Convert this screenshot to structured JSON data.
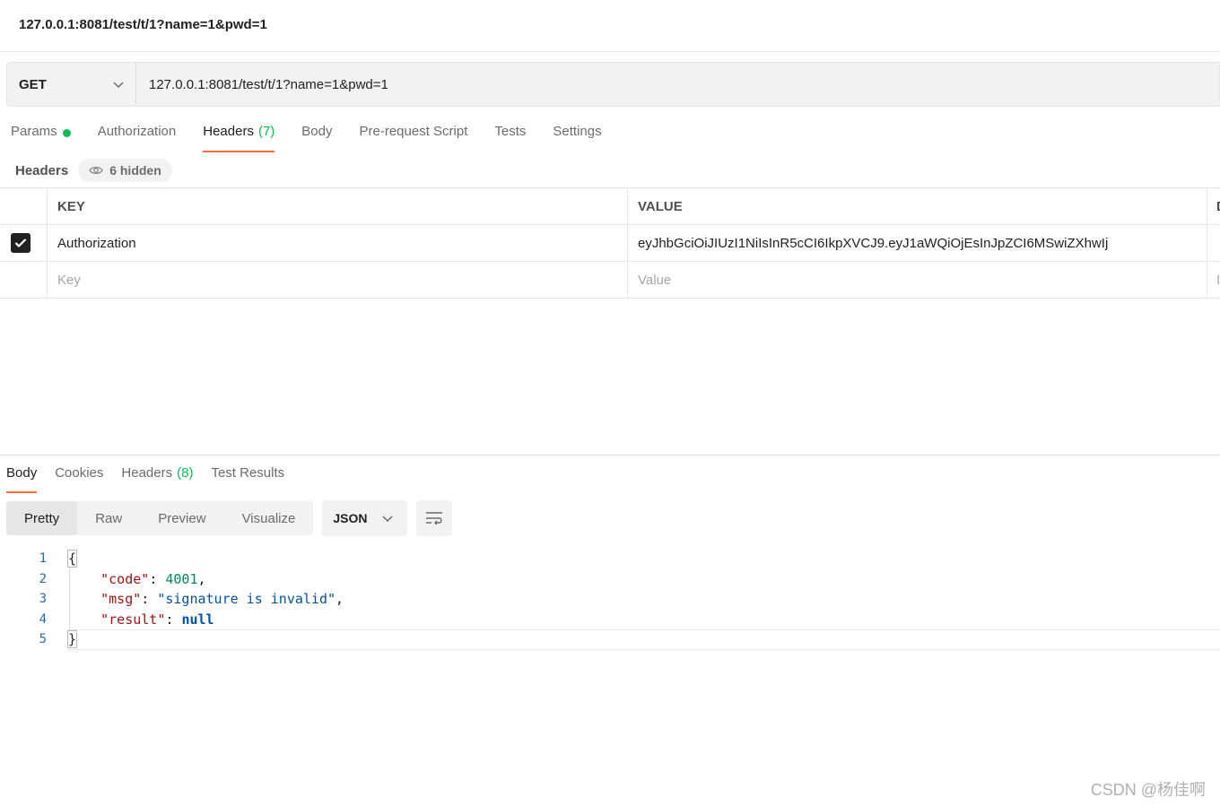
{
  "window": {
    "title": "127.0.0.1:8081/test/t/1?name=1&pwd=1"
  },
  "request": {
    "method": "GET",
    "url": "127.0.0.1:8081/test/t/1?name=1&pwd=1",
    "tabs": {
      "params": "Params",
      "authorization": "Authorization",
      "headers": "Headers",
      "headers_count": "(7)",
      "body": "Body",
      "prerequest": "Pre-request Script",
      "tests": "Tests",
      "settings": "Settings"
    },
    "headers_section": {
      "label": "Headers",
      "hidden": "6 hidden"
    },
    "table": {
      "col_key": "KEY",
      "col_value": "VALUE",
      "col_desc": "D",
      "rows": [
        {
          "key": "Authorization",
          "value": "eyJhbGciOiJIUzI1NiIsInR5cCI6IkpXVCJ9.eyJ1aWQiOjEsInJpZCI6MSwiZXhwIj",
          "checked": true
        }
      ],
      "placeholder_key": "Key",
      "placeholder_value": "Value",
      "placeholder_desc": "I"
    }
  },
  "response": {
    "tabs": {
      "body": "Body",
      "cookies": "Cookies",
      "headers": "Headers",
      "headers_count": "(8)",
      "test_results": "Test Results"
    },
    "views": [
      "Pretty",
      "Raw",
      "Preview",
      "Visualize"
    ],
    "active_view": "Pretty",
    "format": "JSON",
    "code": {
      "line_numbers": [
        "1",
        "2",
        "3",
        "4",
        "5"
      ],
      "open_brace": "{",
      "close_brace": "}",
      "code_key": "\"code\"",
      "code_value": "4001",
      "msg_key": "\"msg\"",
      "msg_value": "\"signature is invalid\"",
      "result_key": "\"result\"",
      "result_value": "null"
    }
  },
  "watermark": "CSDN @杨佳啊",
  "colors": {
    "accent": "#ff6c37",
    "success": "#0cbb52"
  }
}
